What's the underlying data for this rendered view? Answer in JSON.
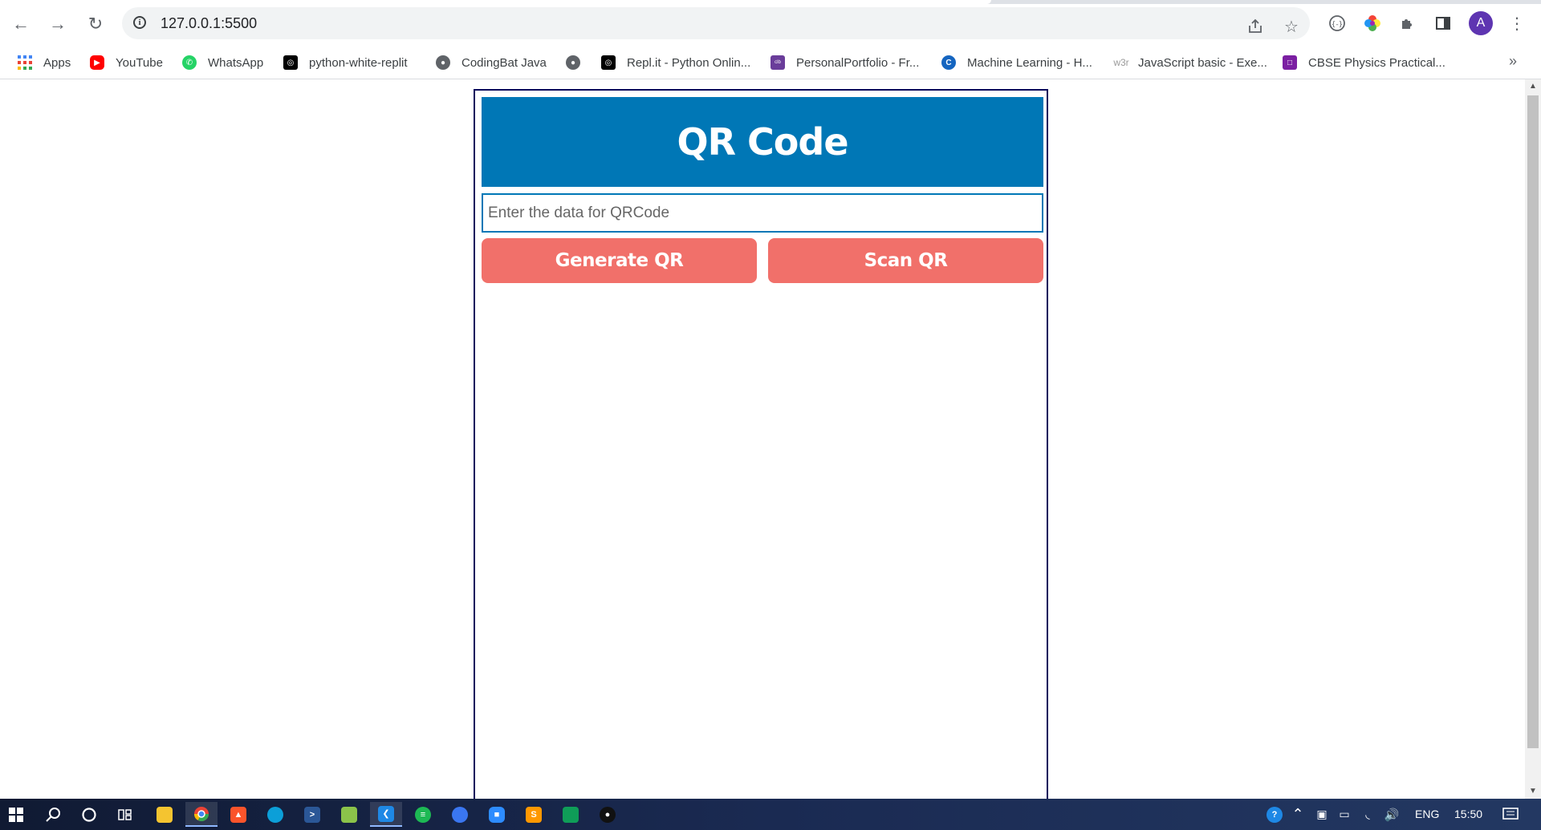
{
  "browser": {
    "url": "127.0.0.1:5500",
    "avatar_letter": "A",
    "bookmarks": [
      {
        "label": "Apps",
        "icon": "apps-grid-icon",
        "color": "#4285f4"
      },
      {
        "label": "YouTube",
        "icon": "youtube-icon",
        "color": "#ff0000"
      },
      {
        "label": "WhatsApp",
        "icon": "whatsapp-icon",
        "color": "#25d366"
      },
      {
        "label": "python-white-replit",
        "icon": "replit-icon",
        "color": "#000000"
      },
      {
        "label": "CodingBat Java",
        "icon": "globe-icon",
        "color": "#5f6368"
      },
      {
        "label": "",
        "icon": "globe-icon",
        "color": "#5f6368"
      },
      {
        "label": "Repl.it - Python Onlin...",
        "icon": "replit-icon",
        "color": "#000000"
      },
      {
        "label": "PersonalPortfolio - Fr...",
        "icon": "colorlib-icon",
        "color": "#6a3d9a"
      },
      {
        "label": "Machine Learning - H...",
        "icon": "c-logo-icon",
        "color": "#1565c0"
      },
      {
        "label": "JavaScript basic - Exe...",
        "icon": "w3r-icon",
        "color": "#999999",
        "icon_text": "w3r"
      },
      {
        "label": "CBSE Physics Practical...",
        "icon": "bookmark-purple-icon",
        "color": "#7b1fa2"
      }
    ]
  },
  "app": {
    "title": "QR Code",
    "input_placeholder": "Enter the data for QRCode",
    "input_value": "",
    "generate_label": "Generate QR",
    "scan_label": "Scan QR",
    "colors": {
      "header": "#0077b6",
      "button": "#f1706a",
      "border": "#0a0a5c"
    }
  },
  "taskbar": {
    "language": "ENG",
    "time": "15:50"
  }
}
